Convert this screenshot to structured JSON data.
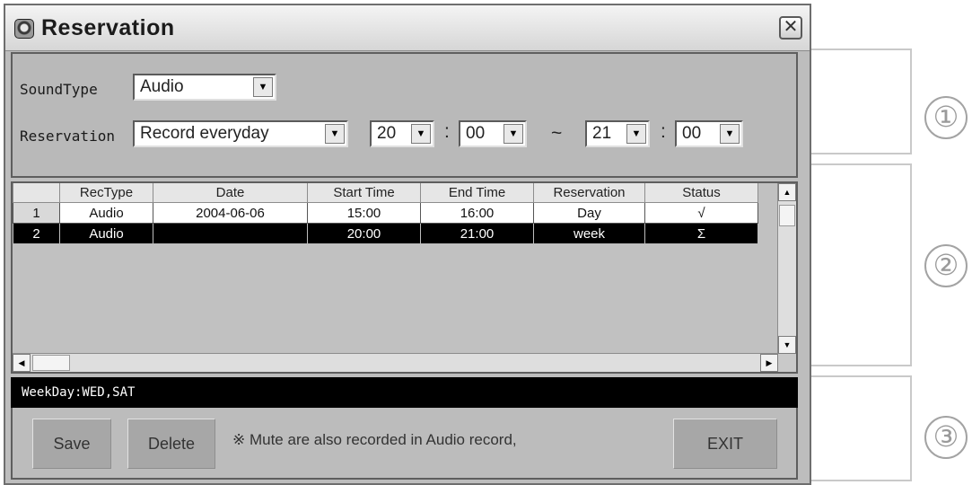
{
  "window": {
    "title": "Reservation",
    "close_glyph": "✕"
  },
  "settings": {
    "sound_type_label": "SoundType",
    "sound_type_value": "Audio",
    "reservation_label": "Reservation",
    "reservation_value": "Record everyday",
    "start_hour": "20",
    "start_minute": "00",
    "time_separator": ":",
    "range_separator": "~",
    "end_hour": "21",
    "end_minute": "00",
    "dropdown_arrow": "▼"
  },
  "table": {
    "columns": [
      "",
      "RecType",
      "Date",
      "Start Time",
      "End Time",
      "Reservation",
      "Status"
    ],
    "rows": [
      {
        "num": "1",
        "rectype": "Audio",
        "date": "2004-06-06",
        "start": "15:00",
        "end": "16:00",
        "reservation": "Day",
        "status": "√"
      },
      {
        "num": "2",
        "rectype": "Audio",
        "date": "",
        "start": "20:00",
        "end": "21:00",
        "reservation": "week",
        "status": "Σ"
      }
    ],
    "selected_row": 2
  },
  "scrollbar_glyphs": {
    "up": "▲",
    "down": "▼",
    "left": "◀",
    "right": "▶"
  },
  "info_bar": {
    "text": "WeekDay:WED,SAT"
  },
  "actions": {
    "save_label": "Save",
    "delete_label": "Delete",
    "note": "※ Mute are also recorded in Audio record,",
    "exit_label": "EXIT"
  },
  "callouts": [
    "①",
    "②",
    "③"
  ],
  "colors": {
    "window_bg": "#bdbdbd",
    "selected_row_bg": "#000000",
    "info_bar_bg": "#000000",
    "callout": "#9a9a9a"
  }
}
